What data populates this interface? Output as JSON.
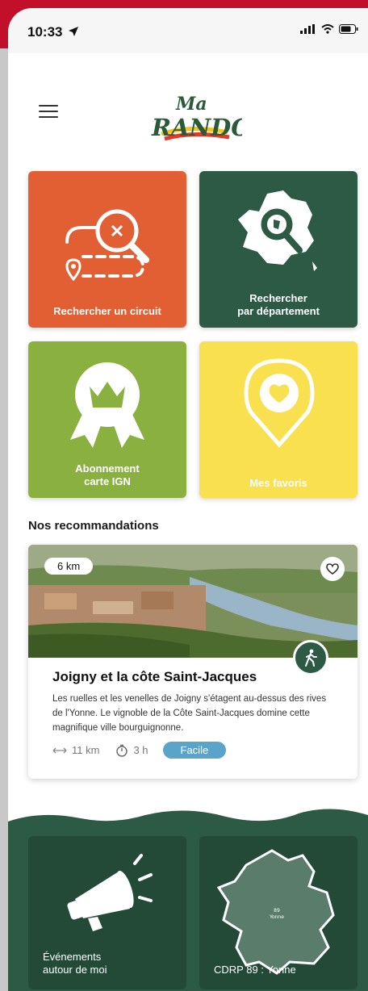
{
  "status_bar": {
    "time": "10:33"
  },
  "header": {
    "logo_top": "Ma",
    "logo_main": "RANDO"
  },
  "tiles": [
    {
      "label": "Rechercher un circuit",
      "color": "#e15f33"
    },
    {
      "label_line1": "Rechercher",
      "label_line2": "par département",
      "color": "#2d5a45"
    },
    {
      "label_line1": "Abonnement",
      "label_line2": "carte IGN",
      "color": "#8ab040"
    },
    {
      "label": "Mes favoris",
      "color": "#f8e04e"
    }
  ],
  "recommendations": {
    "title": "Nos recommandations",
    "card": {
      "distance_badge": "6 km",
      "title": "Joigny et la côte Saint-Jacques",
      "description": "Les ruelles et les venelles de Joigny s'étagent au-dessus des rives de l'Yonne. Le vignoble de la Côte Saint-Jacques domine cette magnifique ville bourguignonne.",
      "distance": "11 km",
      "duration": "3 h",
      "difficulty": "Facile",
      "difficulty_color": "#5aa3c9"
    }
  },
  "bottom_tiles": [
    {
      "label_line1": "Événements",
      "label_line2": "autour de moi"
    },
    {
      "label": "CDRP 89 : Yonne",
      "map_code": "89",
      "map_name": "Yonne"
    }
  ]
}
